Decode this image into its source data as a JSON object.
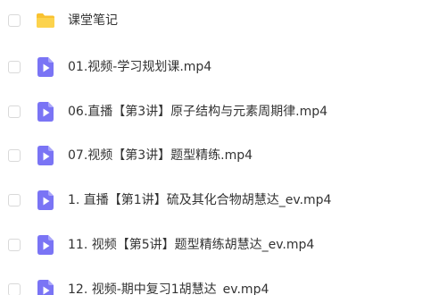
{
  "files": [
    {
      "name": "课堂笔记",
      "type": "folder",
      "icon": "folder-icon"
    },
    {
      "name": "01.视频-学习规划课.mp4",
      "type": "video",
      "icon": "video-file-icon"
    },
    {
      "name": "06.直播【第3讲】原子结构与元素周期律.mp4",
      "type": "video",
      "icon": "video-file-icon"
    },
    {
      "name": "07.视频【第3讲】题型精练.mp4",
      "type": "video",
      "icon": "video-file-icon"
    },
    {
      "name": "1. 直播【第1讲】硫及其化合物胡慧达_ev.mp4",
      "type": "video",
      "icon": "video-file-icon"
    },
    {
      "name": "11. 视频【第5讲】题型精练胡慧达_ev.mp4",
      "type": "video",
      "icon": "video-file-icon"
    },
    {
      "name": "12. 视频-期中复习1胡慧达_ev.mp4",
      "type": "video",
      "icon": "video-file-icon"
    }
  ],
  "colors": {
    "folder": "#f9c230",
    "video": "#7a74f5",
    "text": "#333333",
    "checkbox_border": "#d9d9d9"
  }
}
